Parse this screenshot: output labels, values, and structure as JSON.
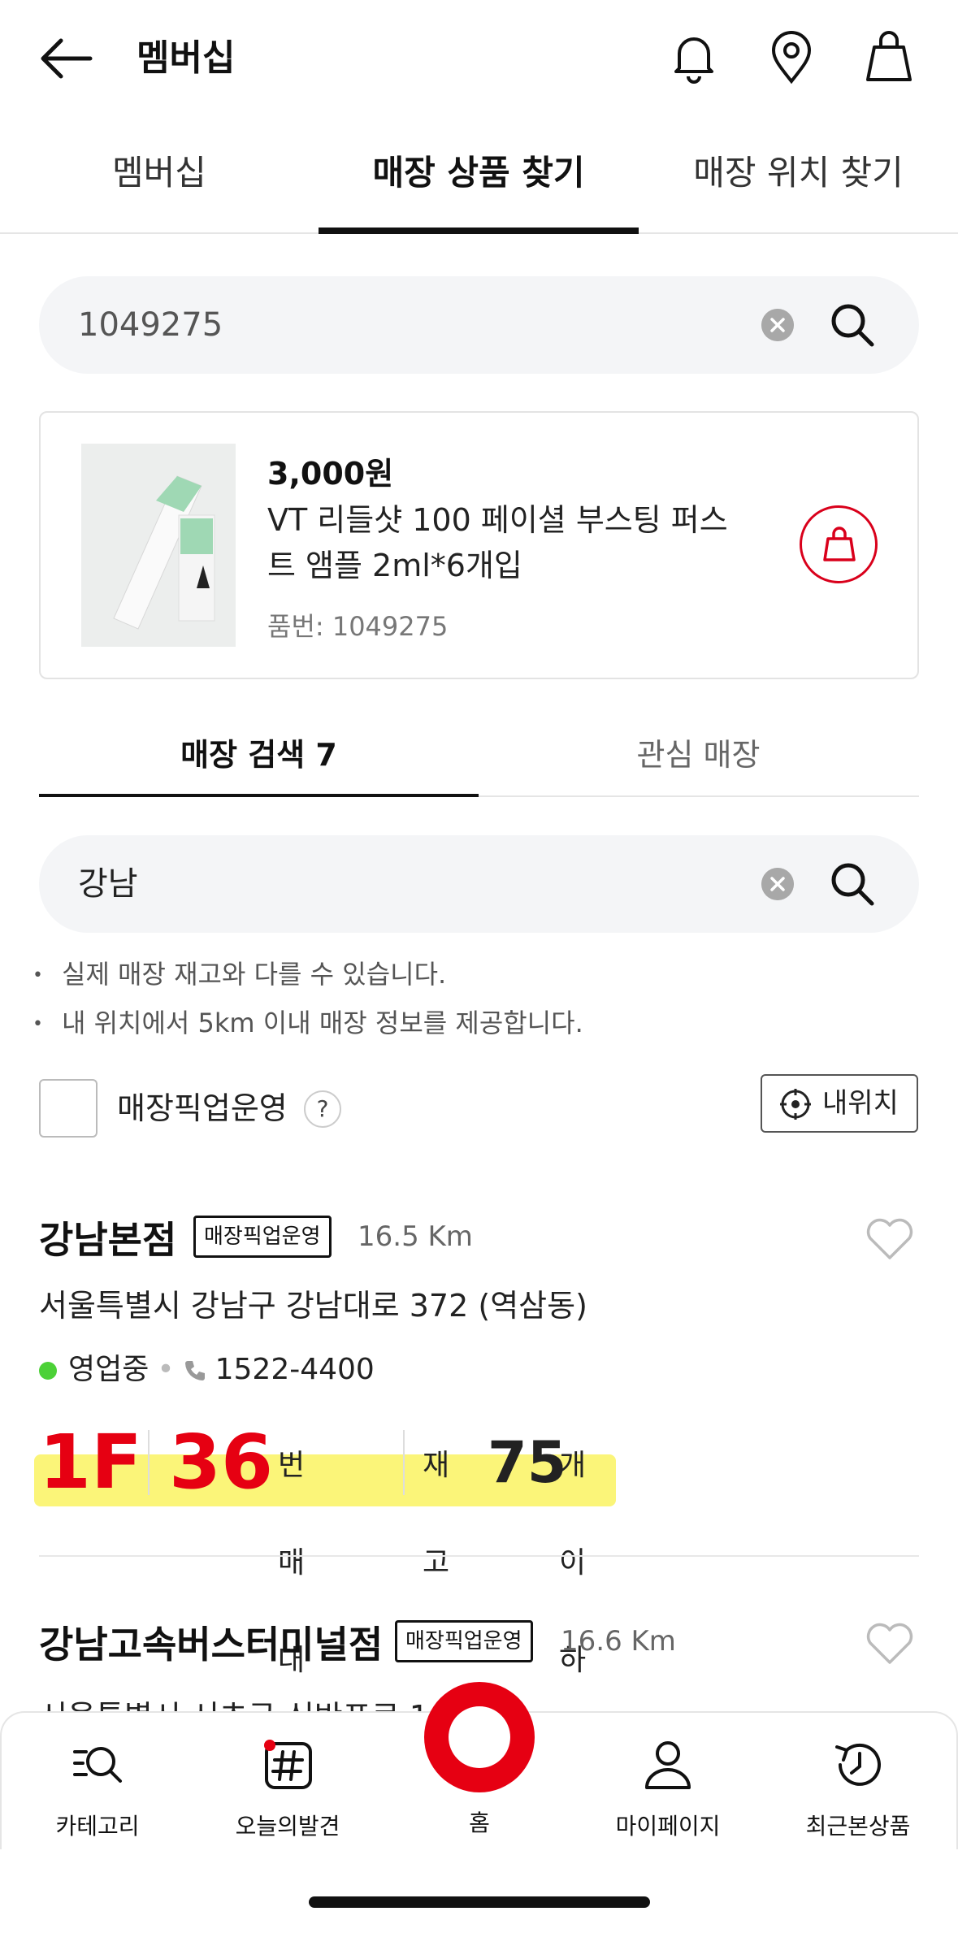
{
  "header": {
    "title": "멤버십",
    "icons": [
      "back-arrow-icon",
      "bell-icon",
      "location-pin-icon",
      "shopping-bag-icon"
    ]
  },
  "tabs": [
    {
      "label": "멤버십",
      "active": false
    },
    {
      "label": "매장 상품 찾기",
      "active": true
    },
    {
      "label": "매장 위치 찾기",
      "active": false
    }
  ],
  "product_search": {
    "value": "1049275"
  },
  "product": {
    "price": "3,000원",
    "name": "VT 리들샷 100 페이셜 부스팅 퍼스트 앰플 2ml*6개입",
    "code": "품번: 1049275"
  },
  "store_tabs": [
    {
      "label": "매장 검색 7",
      "active": true
    },
    {
      "label": "관심 매장",
      "active": false
    }
  ],
  "store_search": {
    "value": "강남"
  },
  "notes": [
    "실제 매장 재고와 다를 수 있습니다.",
    "내 위치에서 5km 이내 매장 정보를 제공합니다."
  ],
  "pickup_filter": {
    "label": "매장픽업운영",
    "help": "?",
    "checked": false
  },
  "my_location_button": "내위치",
  "stores": [
    {
      "name": "강남본점",
      "tag": "매장픽업운영",
      "distance": "16.5 Km",
      "address": "서울특별시 강남구 강남대로 372 (역삼동)",
      "status": "영업중",
      "phone": "1522-4400",
      "floor": "1F",
      "shelf": "36",
      "shelf_suffix": "번 매대",
      "stock_prefix": "재고",
      "stock": "75",
      "stock_suffix": "개 이하"
    },
    {
      "name": "강남고속버스터미널점",
      "tag": "매장픽업운영",
      "distance": "16.6 Km",
      "address_partial": "서울특별시 서초구 신반포로 1"
    }
  ],
  "bottom_nav": [
    {
      "label": "카테고리",
      "icon": "category-search-icon"
    },
    {
      "label": "오늘의발견",
      "icon": "hashtag-icon"
    },
    {
      "label": "홈",
      "icon": "home-circle-icon"
    },
    {
      "label": "마이페이지",
      "icon": "person-icon"
    },
    {
      "label": "최근본상품",
      "icon": "history-icon"
    }
  ],
  "colors": {
    "accent": "#e60012",
    "highlight": "#fbf579",
    "open": "#4cd137"
  }
}
